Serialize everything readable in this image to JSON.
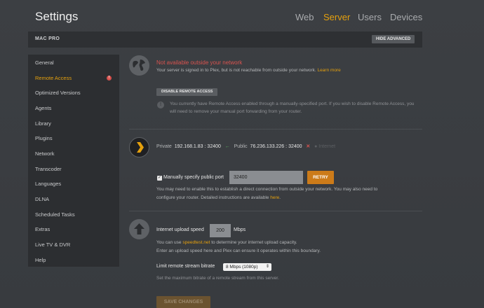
{
  "header": {
    "title": "Settings",
    "nav": [
      "Web",
      "Server",
      "Users",
      "Devices"
    ],
    "active_nav": "Server"
  },
  "server_bar": {
    "name": "MAC PRO",
    "hide_advanced_label": "HIDE ADVANCED"
  },
  "sidebar": {
    "items": [
      {
        "label": "General"
      },
      {
        "label": "Remote Access",
        "active": true,
        "warning": "!"
      },
      {
        "label": "Optimized Versions"
      },
      {
        "label": "Agents"
      },
      {
        "label": "Library"
      },
      {
        "label": "Plugins"
      },
      {
        "label": "Network"
      },
      {
        "label": "Transcoder"
      },
      {
        "label": "Languages"
      },
      {
        "label": "DLNA"
      },
      {
        "label": "Scheduled Tasks"
      },
      {
        "label": "Extras"
      },
      {
        "label": "Live TV & DVR"
      },
      {
        "label": "Help"
      }
    ]
  },
  "status": {
    "title": "Not available outside your network",
    "description": "Your server is signed in to Plex, but is not reachable from outside your network.",
    "learn_more": "Learn more",
    "disable_button": "DISABLE REMOTE ACCESS",
    "info": "You currently have Remote Access enabled through a manually-specified port. If you wish to disable Remote Access, you will need to remove your manual port forwarding from your router."
  },
  "network": {
    "private_label": "Private",
    "private_ip": "192.168.1.83",
    "private_port": "32400",
    "public_label": "Public",
    "public_ip": "76.236.133.226",
    "public_port": "32400",
    "internet_label": "Internet",
    "sep": ":",
    "arrow": "←",
    "fail_mark": "✕"
  },
  "port": {
    "checkbox_label": "Manually specify public port",
    "checked": true,
    "value": "32400",
    "retry_button": "RETRY",
    "help_1": "You may need to enable this to establish a direct connection from outside your network. You may also need to",
    "help_2": "configure your router. Detailed instructions are available",
    "help_link": "here",
    "help_end": "."
  },
  "upload": {
    "label": "Internet upload speed",
    "value": "200",
    "unit": "Mbps",
    "help_1_pre": "You can use",
    "help_1_link": "speedtest.net",
    "help_1_post": "to determine your internet upload capacity.",
    "help_2": "Enter an upload speed here and Plex can ensure it operates within this boundary."
  },
  "bitrate": {
    "label": "Limit remote stream bitrate",
    "selected": "8 Mbps (1080p)",
    "description": "Set the maximum bitrate of a remote stream from this server."
  },
  "save_button": "SAVE CHANGES",
  "colors": {
    "accent": "#e5a00d",
    "error": "#d9534f",
    "success": "#5cb85c",
    "retry": "#cc7b19"
  }
}
